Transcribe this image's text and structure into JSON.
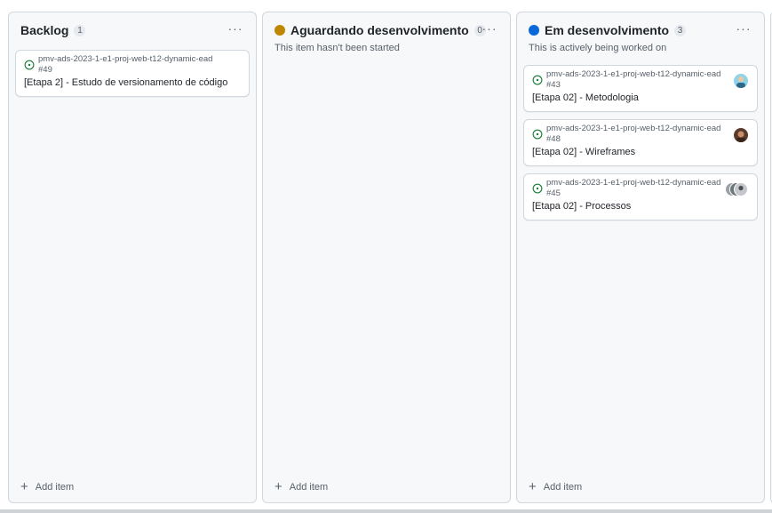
{
  "columns": [
    {
      "title": "Backlog",
      "count": "1",
      "description": "",
      "add_label": "Add item",
      "cards": [
        {
          "ref": "pmv-ads-2023-1-e1-proj-web-t12-dynamic-ead #49",
          "title": "[Etapa 2] - Estudo de versionamento de código"
        }
      ]
    },
    {
      "title": "Aguardando desenvolvimento",
      "count": "0",
      "status_color": "#bf8700",
      "description": "This item hasn't been started",
      "add_label": "Add item",
      "cards": []
    },
    {
      "title": "Em desenvolvimento",
      "count": "3",
      "status_color": "#0969da",
      "description": "This is actively being worked on",
      "add_label": "Add item",
      "cards": [
        {
          "ref": "pmv-ads-2023-1-e1-proj-web-t12-dynamic-ead #43",
          "title": "[Etapa 02] - Metodologia",
          "avatar": "user-avatar"
        },
        {
          "ref": "pmv-ads-2023-1-e1-proj-web-t12-dynamic-ead #48",
          "title": "[Etapa 02] - Wireframes",
          "avatar": "user-avatar"
        },
        {
          "ref": "pmv-ads-2023-1-e1-proj-web-t12-dynamic-ead #45",
          "title": "[Etapa 02] - Processos",
          "avatar": "multiple-user-avatars"
        }
      ]
    }
  ],
  "colors": {
    "issue_open": "#1a7f37",
    "column_bg": "#f6f8fa",
    "border": "#d0d7de"
  }
}
